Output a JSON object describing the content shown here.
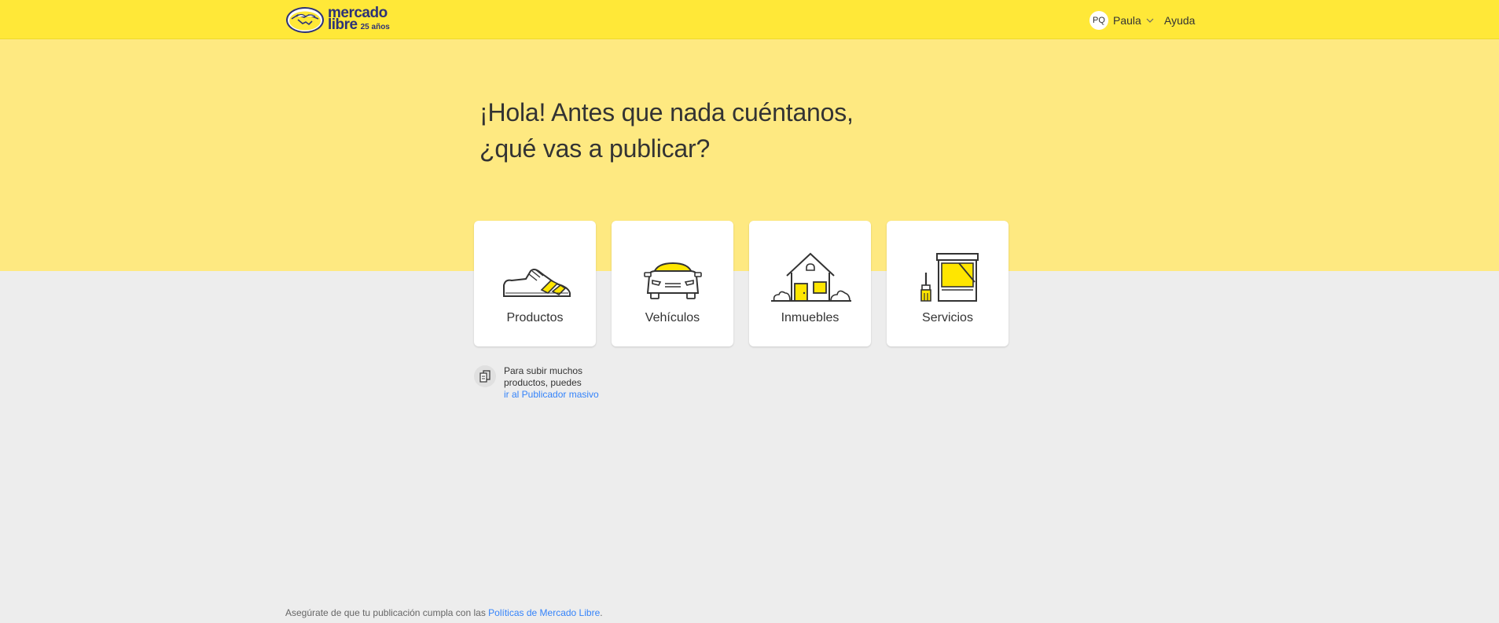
{
  "header": {
    "logo": {
      "line1": "mercado",
      "line2": "libre",
      "badge": "25 años"
    },
    "user": {
      "initials": "PQ",
      "name": "Paula"
    },
    "help": "Ayuda"
  },
  "hero": {
    "title_line1": "¡Hola! Antes que nada cuéntanos,",
    "title_line2": "¿qué vas a publicar?"
  },
  "categories": [
    {
      "label": "Productos",
      "icon": "sneaker-icon"
    },
    {
      "label": "Vehículos",
      "icon": "car-icon"
    },
    {
      "label": "Inmuebles",
      "icon": "house-icon"
    },
    {
      "label": "Servicios",
      "icon": "paint-tools-icon"
    }
  ],
  "bulk": {
    "text": "Para subir muchos productos, puedes",
    "link": "ir al Publicador masivo"
  },
  "footer": {
    "text": "Asegúrate de que tu publicación cumpla con las ",
    "link": "Políticas de Mercado Libre",
    "suffix": "."
  },
  "colors": {
    "brand_yellow": "#ffe838",
    "hero_yellow": "#fee981",
    "link_blue": "#3483fa",
    "logo_navy": "#2d3277"
  }
}
